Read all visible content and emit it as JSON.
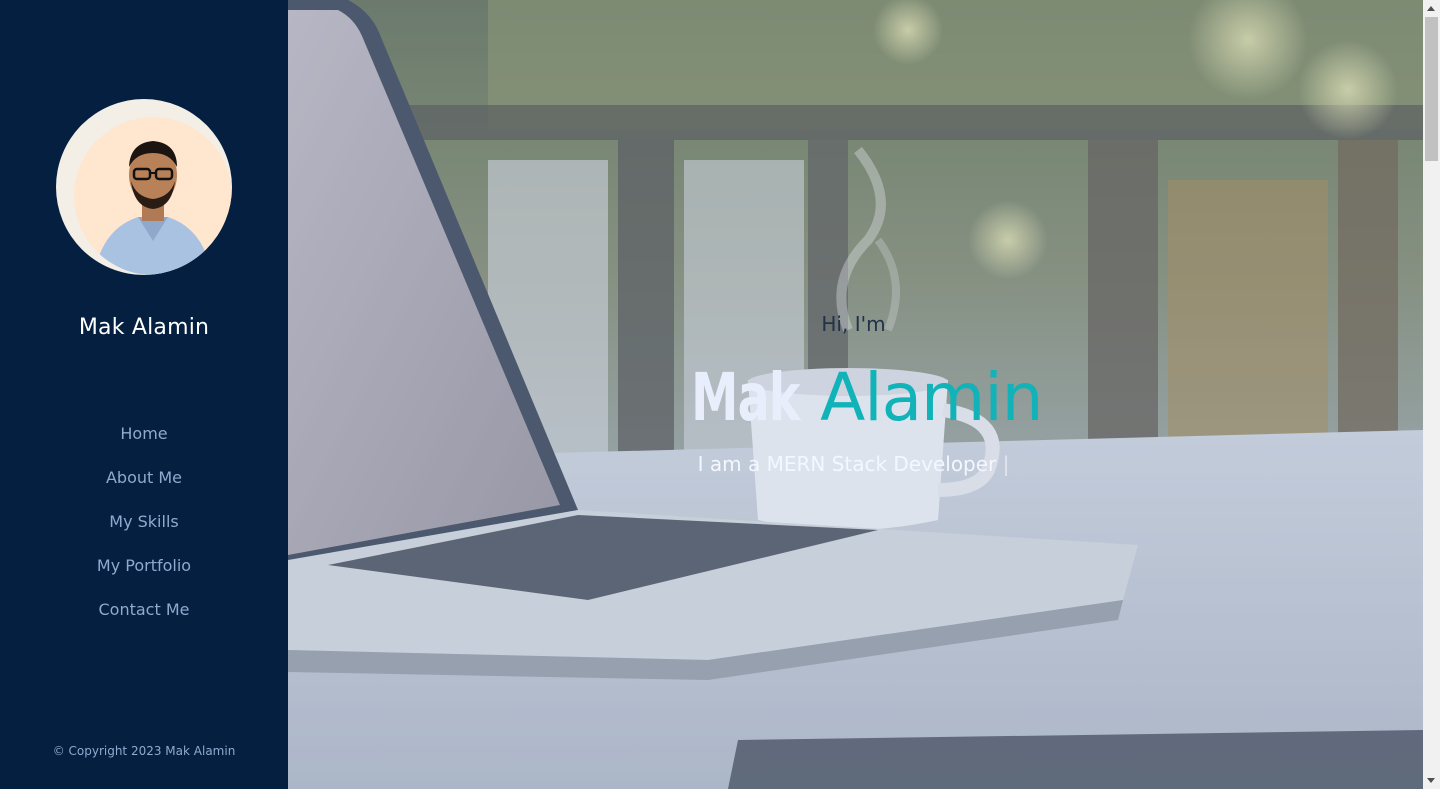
{
  "sidebar": {
    "avatar_icon": "profile-photo",
    "name": "Mak Alamin",
    "nav": [
      {
        "label": "Home"
      },
      {
        "label": "About Me"
      },
      {
        "label": "My Skills"
      },
      {
        "label": "My Portfolio"
      },
      {
        "label": "Contact Me"
      }
    ],
    "copyright": "© Copyright 2023 Mak Alamin"
  },
  "hero": {
    "greeting": "Hi, I'm",
    "name_first": "Mak",
    "name_last": "Alamin",
    "tagline": "I am a MERN Stack Developer",
    "cursor": "|",
    "background_icon": "laptop-coffee-photo"
  },
  "colors": {
    "sidebar_bg": "#051f41",
    "accent": "#11b3b8",
    "nav_text": "#8fa9cf"
  }
}
